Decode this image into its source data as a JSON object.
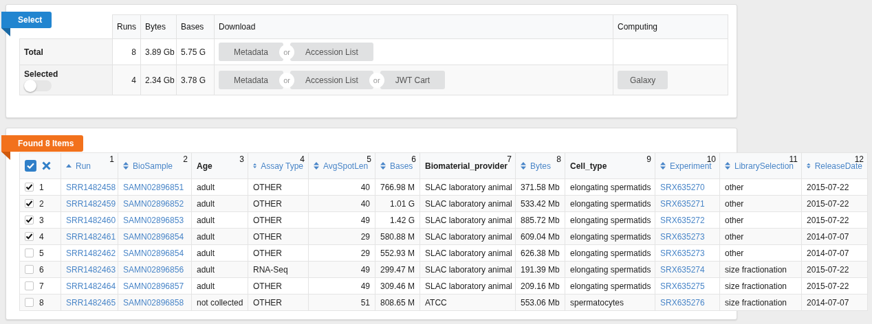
{
  "summary": {
    "badge": "Select",
    "columns": [
      "Runs",
      "Bytes",
      "Bases",
      "Download",
      "Computing"
    ],
    "rows": [
      {
        "label": "Total",
        "runs": "8",
        "bytes": "3.89 Gb",
        "bases": "5.75 G",
        "download": [
          {
            "kind": "button",
            "label": "Metadata"
          },
          {
            "kind": "or",
            "label": "or"
          },
          {
            "kind": "button",
            "label": "Accession List"
          }
        ]
      },
      {
        "label": "Selected",
        "toggle": {
          "on": false
        },
        "runs": "4",
        "bytes": "2.34 Gb",
        "bases": "3.78 G",
        "download": [
          {
            "kind": "button",
            "label": "Metadata"
          },
          {
            "kind": "or",
            "label": "or"
          },
          {
            "kind": "button",
            "label": "Accession List"
          },
          {
            "kind": "or",
            "label": "or"
          },
          {
            "kind": "button",
            "label": "JWT Cart"
          }
        ],
        "computing": [
          "Galaxy"
        ]
      }
    ]
  },
  "results": {
    "badge": "Found 8 Items",
    "select_all": {
      "checked": true
    },
    "columns": [
      {
        "label": "Run",
        "number": "1",
        "sortable": true,
        "sorted": true,
        "link": true
      },
      {
        "label": "BioSample",
        "number": "2",
        "sortable": true,
        "sorted": false,
        "link": true
      },
      {
        "label": "Age",
        "number": "3",
        "sortable": false
      },
      {
        "label": "Assay Type",
        "number": "4",
        "sortable": true,
        "sorted": false
      },
      {
        "label": "AvgSpotLen",
        "number": "5",
        "sortable": true,
        "sorted": false,
        "numeric": true
      },
      {
        "label": "Bases",
        "number": "6",
        "sortable": true,
        "sorted": false,
        "numeric": true
      },
      {
        "label": "Biomaterial_provider",
        "number": "7",
        "sortable": false
      },
      {
        "label": "Bytes",
        "number": "8",
        "sortable": true,
        "sorted": false
      },
      {
        "label": "Cell_type",
        "number": "9",
        "sortable": false
      },
      {
        "label": "Experiment",
        "number": "10",
        "sortable": true,
        "sorted": false,
        "link": true
      },
      {
        "label": "LibrarySelection",
        "number": "11",
        "sortable": true,
        "sorted": false
      },
      {
        "label": "ReleaseDate",
        "number": "12",
        "sortable": true,
        "sorted": false
      }
    ],
    "rows": [
      {
        "checked": true,
        "index": "1",
        "cells": [
          "SRR1482458",
          "SAMN02896851",
          "adult",
          "OTHER",
          "40",
          "766.98 M",
          "SLAC laboratory animal",
          "371.58 Mb",
          "elongating spermatids",
          "SRX635270",
          "other",
          "2015-07-22"
        ]
      },
      {
        "checked": true,
        "index": "2",
        "cells": [
          "SRR1482459",
          "SAMN02896852",
          "adult",
          "OTHER",
          "40",
          "1.01 G",
          "SLAC laboratory animal",
          "533.42 Mb",
          "elongating spermatids",
          "SRX635271",
          "other",
          "2015-07-22"
        ]
      },
      {
        "checked": true,
        "index": "3",
        "cells": [
          "SRR1482460",
          "SAMN02896853",
          "adult",
          "OTHER",
          "49",
          "1.42 G",
          "SLAC laboratory animal",
          "885.72 Mb",
          "elongating spermatids",
          "SRX635272",
          "other",
          "2015-07-22"
        ]
      },
      {
        "checked": true,
        "index": "4",
        "cells": [
          "SRR1482461",
          "SAMN02896854",
          "adult",
          "OTHER",
          "29",
          "580.88 M",
          "SLAC laboratory animal",
          "609.04 Mb",
          "elongating spermatids",
          "SRX635273",
          "other",
          "2014-07-07"
        ]
      },
      {
        "checked": false,
        "index": "5",
        "cells": [
          "SRR1482462",
          "SAMN02896854",
          "adult",
          "OTHER",
          "29",
          "552.93 M",
          "SLAC laboratory animal",
          "626.38 Mb",
          "elongating spermatids",
          "SRX635273",
          "other",
          "2014-07-07"
        ]
      },
      {
        "checked": false,
        "index": "6",
        "cells": [
          "SRR1482463",
          "SAMN02896856",
          "adult",
          "RNA-Seq",
          "49",
          "299.47 M",
          "SLAC laboratory animal",
          "191.39 Mb",
          "elongating spermatids",
          "SRX635274",
          "size fractionation",
          "2015-07-22"
        ]
      },
      {
        "checked": false,
        "index": "7",
        "cells": [
          "SRR1482464",
          "SAMN02896857",
          "adult",
          "OTHER",
          "49",
          "309.46 M",
          "SLAC laboratory animal",
          "209.16 Mb",
          "elongating spermatids",
          "SRX635275",
          "size fractionation",
          "2015-07-22"
        ]
      },
      {
        "checked": false,
        "index": "8",
        "cells": [
          "SRR1482465",
          "SAMN02896858",
          "not collected",
          "OTHER",
          "51",
          "808.65 M",
          "ATCC",
          "553.06 Mb",
          "spermatocytes",
          "SRX635276",
          "size fractionation",
          "2014-07-07"
        ]
      }
    ]
  }
}
